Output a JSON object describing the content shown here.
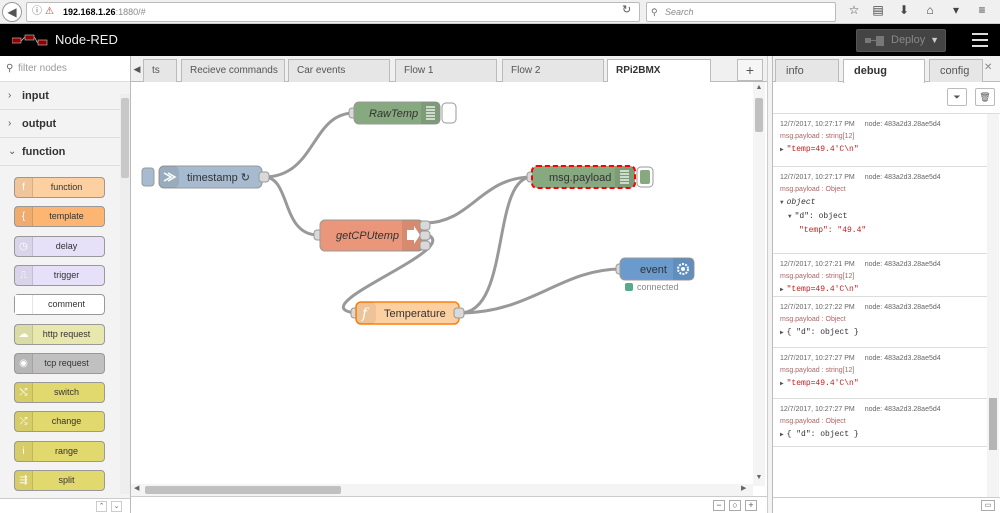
{
  "browser": {
    "url_host": "192.168.1.26",
    "url_path": ":1880/#",
    "search_placeholder": "Search"
  },
  "header": {
    "title": "Node-RED",
    "deploy_label": "Deploy"
  },
  "palette": {
    "filter_placeholder": "filter nodes",
    "categories": [
      {
        "label": "input",
        "expanded": false
      },
      {
        "label": "output",
        "expanded": false
      },
      {
        "label": "function",
        "expanded": true
      }
    ],
    "nodes": [
      {
        "label": "function",
        "color": "#fdd0a2",
        "icon": "f"
      },
      {
        "label": "template",
        "color": "#fdb574",
        "icon": "{"
      },
      {
        "label": "delay",
        "color": "#e6e0f8",
        "icon": "◷"
      },
      {
        "label": "trigger",
        "color": "#e6e0f8",
        "icon": "⎍"
      },
      {
        "label": "comment",
        "color": "#ffffff",
        "icon": ""
      },
      {
        "label": "http request",
        "color": "#e7e7ae",
        "icon": "☁"
      },
      {
        "label": "tcp request",
        "color": "#c0c0c0",
        "icon": "◉"
      },
      {
        "label": "switch",
        "color": "#e2d96e",
        "icon": "⤭"
      },
      {
        "label": "change",
        "color": "#e2d96e",
        "icon": "⤮"
      },
      {
        "label": "range",
        "color": "#e2d96e",
        "icon": "i"
      },
      {
        "label": "split",
        "color": "#e2d96e",
        "icon": "⇶"
      }
    ]
  },
  "tabs": {
    "items": [
      {
        "label": "ts",
        "active": false
      },
      {
        "label": "Recieve commands",
        "active": false
      },
      {
        "label": "Car events",
        "active": false
      },
      {
        "label": "Flow 1",
        "active": false
      },
      {
        "label": "Flow 2",
        "active": false
      },
      {
        "label": "RPi2BMX",
        "active": true
      }
    ],
    "add_label": "+"
  },
  "flow": {
    "nodes": {
      "timestamp": {
        "label": "timestamp ↻",
        "color": "#a6bbcf"
      },
      "rawtemp": {
        "label": "RawTemp",
        "color": "#87a980"
      },
      "getcpu": {
        "label": "getCPUtemp",
        "color": "#e9967a"
      },
      "msgpayload": {
        "label": "msg.payload",
        "color": "#87a980"
      },
      "temperature": {
        "label": "Temperature",
        "color": "#fdd0a2"
      },
      "event": {
        "label": "event",
        "color": "#6a9bcc",
        "status": "connected",
        "status_color": "#5a8"
      }
    }
  },
  "sidebar": {
    "tabs": [
      {
        "label": "info",
        "active": false
      },
      {
        "label": "debug",
        "active": true
      },
      {
        "label": "config",
        "active": false
      }
    ],
    "messages": [
      {
        "time": "12/7/2017, 10:27:17 PM",
        "node": "node: 483a2d3.28ae5d4",
        "topic": "msg.payload : string[12]",
        "lines": [
          "\"temp=49.4'C\\n\""
        ]
      },
      {
        "time": "12/7/2017, 10:27:17 PM",
        "node": "node: 483a2d3.28ae5d4",
        "topic": "msg.payload : Object",
        "lines": [
          "object",
          "\"d\": object",
          "\"temp\": \"49.4\""
        ]
      },
      {
        "time": "12/7/2017, 10:27:21 PM",
        "node": "node: 483a2d3.28ae5d4",
        "topic": "msg.payload : string[12]",
        "lines": [
          "\"temp=49.4'C\\n\""
        ]
      },
      {
        "time": "12/7/2017, 10:27:22 PM",
        "node": "node: 483a2d3.28ae5d4",
        "topic": "msg.payload : Object",
        "lines": [
          "{ \"d\": object }"
        ]
      },
      {
        "time": "12/7/2017, 10:27:27 PM",
        "node": "node: 483a2d3.28ae5d4",
        "topic": "msg.payload : string[12]",
        "lines": [
          "\"temp=49.4'C\\n\""
        ]
      },
      {
        "time": "12/7/2017, 10:27:27 PM",
        "node": "node: 483a2d3.28ae5d4",
        "topic": "msg.payload : Object",
        "lines": [
          "{ \"d\": object }"
        ]
      }
    ]
  },
  "colors": {
    "header_bg": "#000000",
    "logo_red": "#8f0000",
    "selected_outline": "#ff0000"
  }
}
